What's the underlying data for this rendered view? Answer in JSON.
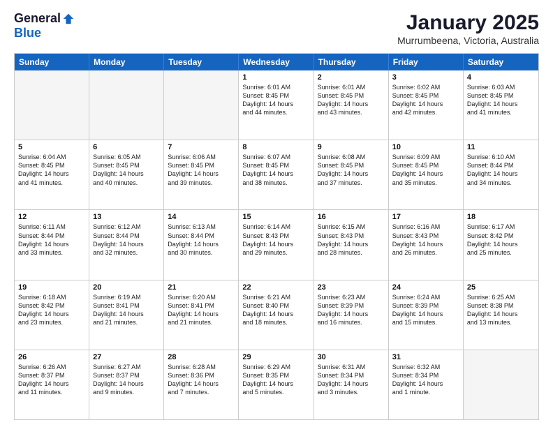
{
  "logo": {
    "general": "General",
    "blue": "Blue"
  },
  "title": "January 2025",
  "location": "Murrumbeena, Victoria, Australia",
  "headers": [
    "Sunday",
    "Monday",
    "Tuesday",
    "Wednesday",
    "Thursday",
    "Friday",
    "Saturday"
  ],
  "rows": [
    [
      {
        "day": "",
        "info": "",
        "empty": true
      },
      {
        "day": "",
        "info": "",
        "empty": true
      },
      {
        "day": "",
        "info": "",
        "empty": true
      },
      {
        "day": "1",
        "info": "Sunrise: 6:01 AM\nSunset: 8:45 PM\nDaylight: 14 hours\nand 44 minutes."
      },
      {
        "day": "2",
        "info": "Sunrise: 6:01 AM\nSunset: 8:45 PM\nDaylight: 14 hours\nand 43 minutes."
      },
      {
        "day": "3",
        "info": "Sunrise: 6:02 AM\nSunset: 8:45 PM\nDaylight: 14 hours\nand 42 minutes."
      },
      {
        "day": "4",
        "info": "Sunrise: 6:03 AM\nSunset: 8:45 PM\nDaylight: 14 hours\nand 41 minutes."
      }
    ],
    [
      {
        "day": "5",
        "info": "Sunrise: 6:04 AM\nSunset: 8:45 PM\nDaylight: 14 hours\nand 41 minutes."
      },
      {
        "day": "6",
        "info": "Sunrise: 6:05 AM\nSunset: 8:45 PM\nDaylight: 14 hours\nand 40 minutes."
      },
      {
        "day": "7",
        "info": "Sunrise: 6:06 AM\nSunset: 8:45 PM\nDaylight: 14 hours\nand 39 minutes."
      },
      {
        "day": "8",
        "info": "Sunrise: 6:07 AM\nSunset: 8:45 PM\nDaylight: 14 hours\nand 38 minutes."
      },
      {
        "day": "9",
        "info": "Sunrise: 6:08 AM\nSunset: 8:45 PM\nDaylight: 14 hours\nand 37 minutes."
      },
      {
        "day": "10",
        "info": "Sunrise: 6:09 AM\nSunset: 8:45 PM\nDaylight: 14 hours\nand 35 minutes."
      },
      {
        "day": "11",
        "info": "Sunrise: 6:10 AM\nSunset: 8:44 PM\nDaylight: 14 hours\nand 34 minutes."
      }
    ],
    [
      {
        "day": "12",
        "info": "Sunrise: 6:11 AM\nSunset: 8:44 PM\nDaylight: 14 hours\nand 33 minutes."
      },
      {
        "day": "13",
        "info": "Sunrise: 6:12 AM\nSunset: 8:44 PM\nDaylight: 14 hours\nand 32 minutes."
      },
      {
        "day": "14",
        "info": "Sunrise: 6:13 AM\nSunset: 8:44 PM\nDaylight: 14 hours\nand 30 minutes."
      },
      {
        "day": "15",
        "info": "Sunrise: 6:14 AM\nSunset: 8:43 PM\nDaylight: 14 hours\nand 29 minutes."
      },
      {
        "day": "16",
        "info": "Sunrise: 6:15 AM\nSunset: 8:43 PM\nDaylight: 14 hours\nand 28 minutes."
      },
      {
        "day": "17",
        "info": "Sunrise: 6:16 AM\nSunset: 8:43 PM\nDaylight: 14 hours\nand 26 minutes."
      },
      {
        "day": "18",
        "info": "Sunrise: 6:17 AM\nSunset: 8:42 PM\nDaylight: 14 hours\nand 25 minutes."
      }
    ],
    [
      {
        "day": "19",
        "info": "Sunrise: 6:18 AM\nSunset: 8:42 PM\nDaylight: 14 hours\nand 23 minutes."
      },
      {
        "day": "20",
        "info": "Sunrise: 6:19 AM\nSunset: 8:41 PM\nDaylight: 14 hours\nand 21 minutes."
      },
      {
        "day": "21",
        "info": "Sunrise: 6:20 AM\nSunset: 8:41 PM\nDaylight: 14 hours\nand 21 minutes."
      },
      {
        "day": "22",
        "info": "Sunrise: 6:21 AM\nSunset: 8:40 PM\nDaylight: 14 hours\nand 18 minutes."
      },
      {
        "day": "23",
        "info": "Sunrise: 6:23 AM\nSunset: 8:39 PM\nDaylight: 14 hours\nand 16 minutes."
      },
      {
        "day": "24",
        "info": "Sunrise: 6:24 AM\nSunset: 8:39 PM\nDaylight: 14 hours\nand 15 minutes."
      },
      {
        "day": "25",
        "info": "Sunrise: 6:25 AM\nSunset: 8:38 PM\nDaylight: 14 hours\nand 13 minutes."
      }
    ],
    [
      {
        "day": "26",
        "info": "Sunrise: 6:26 AM\nSunset: 8:37 PM\nDaylight: 14 hours\nand 11 minutes."
      },
      {
        "day": "27",
        "info": "Sunrise: 6:27 AM\nSunset: 8:37 PM\nDaylight: 14 hours\nand 9 minutes."
      },
      {
        "day": "28",
        "info": "Sunrise: 6:28 AM\nSunset: 8:36 PM\nDaylight: 14 hours\nand 7 minutes."
      },
      {
        "day": "29",
        "info": "Sunrise: 6:29 AM\nSunset: 8:35 PM\nDaylight: 14 hours\nand 5 minutes."
      },
      {
        "day": "30",
        "info": "Sunrise: 6:31 AM\nSunset: 8:34 PM\nDaylight: 14 hours\nand 3 minutes."
      },
      {
        "day": "31",
        "info": "Sunrise: 6:32 AM\nSunset: 8:34 PM\nDaylight: 14 hours\nand 1 minute."
      },
      {
        "day": "",
        "info": "",
        "empty": true
      }
    ]
  ]
}
